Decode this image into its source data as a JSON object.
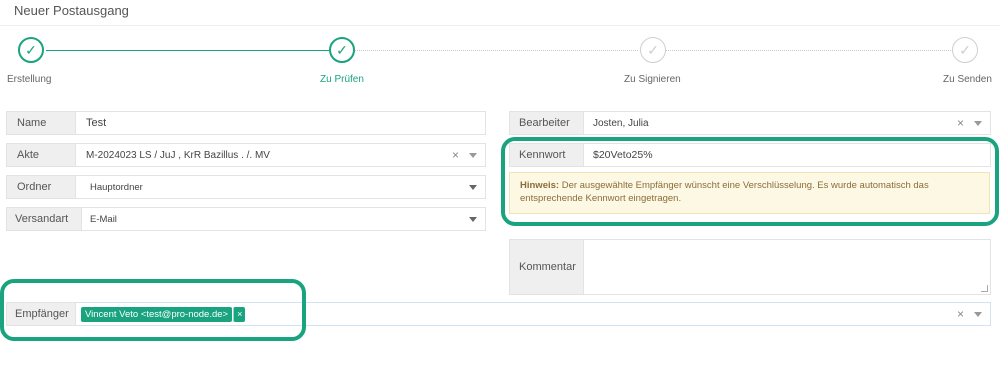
{
  "window": {
    "title": "Neuer Postausgang"
  },
  "stepper": {
    "steps": [
      {
        "label": "Erstellung",
        "state": "done"
      },
      {
        "label": "Zu Prüfen",
        "state": "done"
      },
      {
        "label": "Zu Signieren",
        "state": "todo"
      },
      {
        "label": "Zu Senden",
        "state": "todo"
      }
    ]
  },
  "form": {
    "name": {
      "label": "Name",
      "value": "Test"
    },
    "akte": {
      "label": "Akte",
      "value": "M-2024023 LS / JuJ ,  KrR Bazillus . /. MV",
      "clear": "×"
    },
    "ordner": {
      "label": "Ordner",
      "value": "Hauptordner"
    },
    "versandart": {
      "label": "Versandart",
      "value": "E-Mail"
    },
    "bearbeiter": {
      "label": "Bearbeiter",
      "value": "Josten, Julia",
      "clear": "×"
    },
    "kennwort": {
      "label": "Kennwort",
      "value": "$20Veto25%"
    },
    "hint": {
      "prefix": "Hinweis:",
      "text": " Der ausgewählte Empfänger wünscht eine Verschlüsselung. Es wurde automatisch das entsprechende Kennwort eingetragen."
    },
    "kommentar": {
      "label": "Kommentar",
      "value": ""
    },
    "empfaenger": {
      "label": "Empfänger",
      "tag": "Vincent Veto <test@pro-node.de>",
      "tag_remove": "×",
      "clear": "×"
    }
  },
  "colors": {
    "accent": "#1aa37f",
    "hint_bg": "#fcf8e3",
    "hint_text": "#8a6d3b"
  },
  "icons": {
    "step_done": "check-circle-icon",
    "step_todo": "check-circle-outline-icon"
  }
}
